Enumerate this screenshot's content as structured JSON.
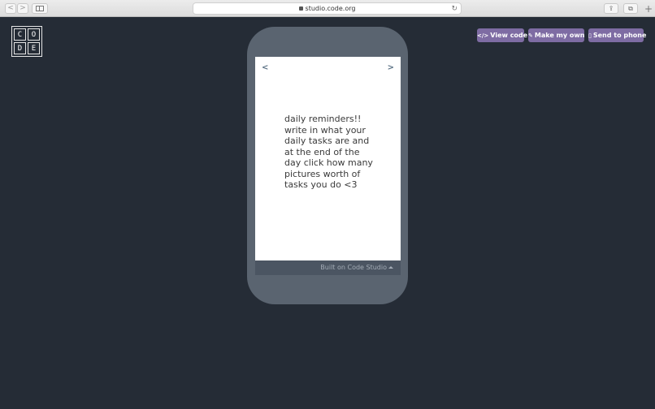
{
  "browser": {
    "url": "studio.code.org",
    "back_icon": "<",
    "forward_icon": ">",
    "reload_icon": "↻",
    "share_icon": "⇪",
    "tabs_icon": "⧉",
    "new_tab_icon": "+"
  },
  "logo": {
    "letters": [
      "C",
      "O",
      "D",
      "E"
    ]
  },
  "toolbar": {
    "view_code_icon": "</>",
    "view_code_label": "View code",
    "make_my_own_icon": "✎",
    "make_my_own_label": "Make my own",
    "send_to_phone_icon": "▯",
    "send_to_phone_label": "Send to phone",
    "button_color": "#7e6ca3"
  },
  "app": {
    "prev_label": "<",
    "next_label": ">",
    "text": "daily reminders!! write in what your daily tasks are and at the end of the day click how many pictures worth of tasks you do <3"
  },
  "footer": {
    "label": "Built on Code Studio"
  },
  "colors": {
    "background": "#252c36",
    "phone_frame": "#5a6470",
    "footer_bar": "#4b5562"
  }
}
